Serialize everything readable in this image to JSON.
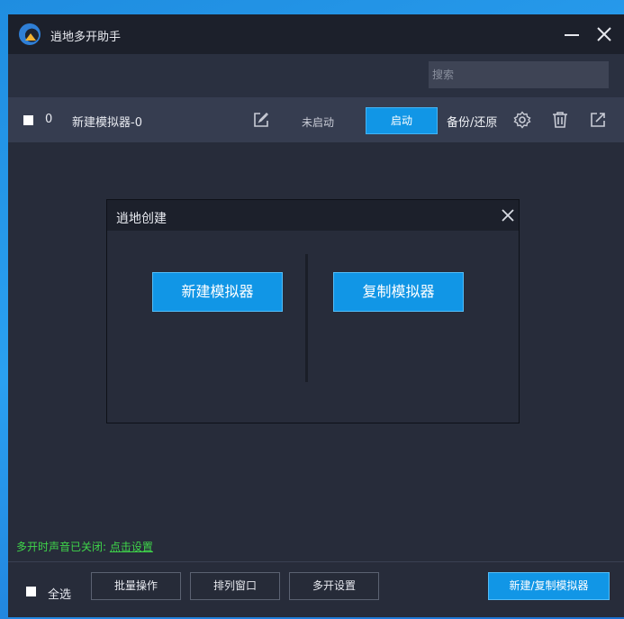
{
  "window": {
    "title": "逍地多开助手"
  },
  "toolbar": {
    "search_placeholder": "搜索"
  },
  "emulator_row": {
    "index": "0",
    "name": "新建模拟器-0",
    "status": "未启动",
    "start_label": "启动",
    "backup_label": "备份/还原"
  },
  "dialog": {
    "title": "逍地创建",
    "new_label": "新建模拟器",
    "copy_label": "复制模拟器"
  },
  "notice": {
    "text": "多开时声音已关闭: ",
    "link": "点击设置"
  },
  "footer": {
    "select_all": "全选",
    "batch_label": "批量操作",
    "arrange_label": "排列窗口",
    "multi_label": "多开设置",
    "new_copy_label": "新建/复制模拟器"
  },
  "colors": {
    "accent": "#1196e6",
    "window_bg": "#272c3a",
    "titlebar_bg": "#1c202b",
    "row_bg": "#363d50",
    "notice_green": "#3fd64a"
  }
}
